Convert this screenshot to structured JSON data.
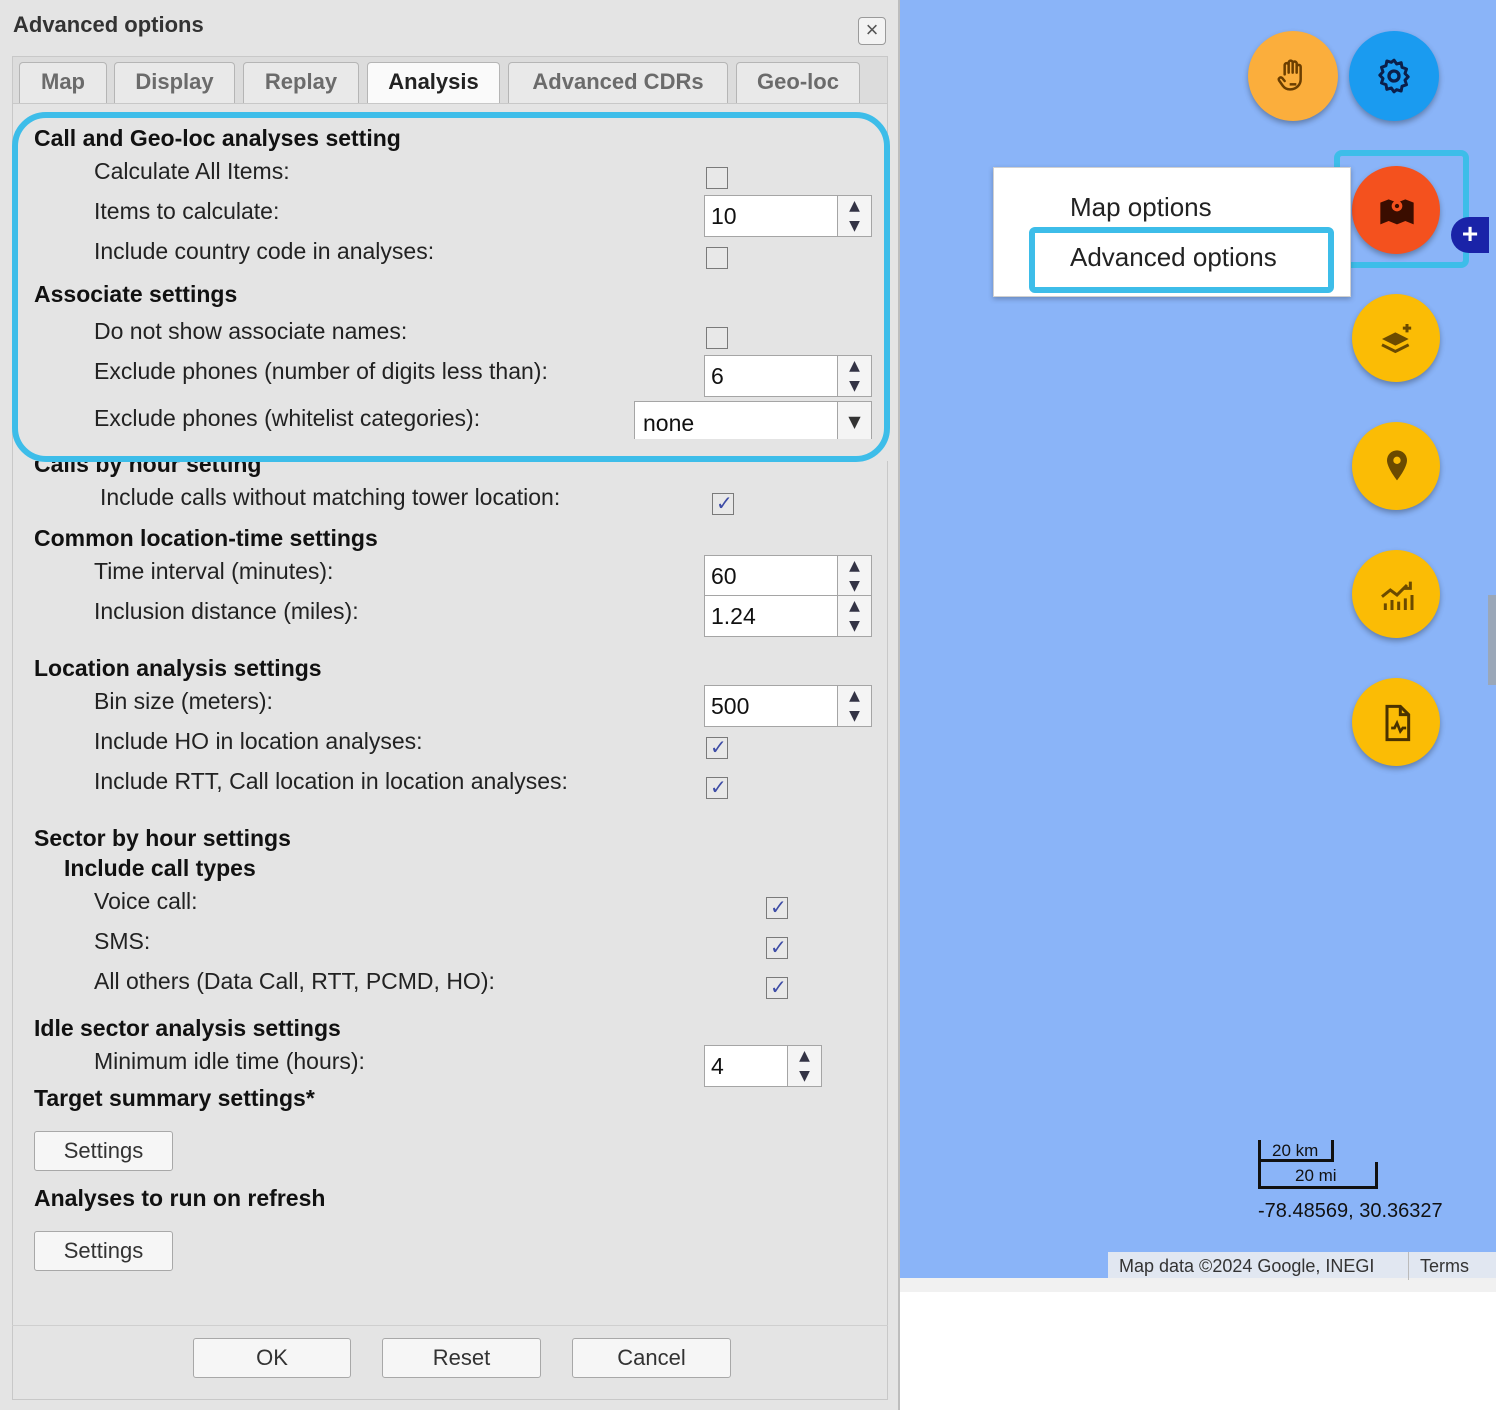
{
  "dialog": {
    "title": "Advanced options",
    "close_glyph": "×",
    "tabs": [
      "Map",
      "Display",
      "Replay",
      "Analysis",
      "Advanced CDRs",
      "Geo-loc"
    ],
    "active_tab": "Analysis",
    "sections": {
      "call_geo": {
        "heading": "Call and Geo-loc analyses setting",
        "calc_all_label": "Calculate All Items:",
        "calc_all_checked": false,
        "items_label": "Items to calculate:",
        "items_value": "10",
        "country_label": "Include country code in analyses:",
        "country_checked": false
      },
      "associate": {
        "heading": "Associate settings",
        "no_names_label": "Do not show associate names:",
        "no_names_checked": false,
        "exclude_digits_label": "Exclude phones (number of digits less than):",
        "exclude_digits_value": "6",
        "exclude_whitelist_label": "Exclude phones (whitelist categories):",
        "exclude_whitelist_value": "none"
      },
      "calls_by_hour": {
        "heading": "Calls by hour setting",
        "include_calls_label": "Include calls without matching tower location:",
        "include_calls_checked": true
      },
      "common": {
        "heading": "Common location-time settings",
        "interval_label": "Time interval (minutes):",
        "interval_value": "60",
        "distance_label": "Inclusion distance (miles):",
        "distance_value": "1.24"
      },
      "location": {
        "heading": "Location analysis settings",
        "bin_label": "Bin size (meters):",
        "bin_value": "500",
        "ho_label": "Include HO in location analyses:",
        "ho_checked": true,
        "rtt_label": "Include RTT, Call location in location analyses:",
        "rtt_checked": true
      },
      "sector": {
        "heading": "Sector by hour settings",
        "subheading": "Include call types",
        "voice_label": "Voice call:",
        "voice_checked": true,
        "sms_label": "SMS:",
        "sms_checked": true,
        "others_label": "All others (Data Call, RTT, PCMD, HO):",
        "others_checked": true
      },
      "idle": {
        "heading": "Idle sector analysis settings",
        "min_label": "Minimum idle time (hours):",
        "min_value": "4"
      },
      "target": {
        "heading": "Target summary settings*",
        "button": "Settings"
      },
      "refresh": {
        "heading": "Analyses to run on refresh",
        "button": "Settings"
      }
    },
    "footer": {
      "ok": "OK",
      "reset": "Reset",
      "cancel": "Cancel"
    }
  },
  "map": {
    "menu": {
      "map_options": "Map options",
      "advanced_options": "Advanced options"
    },
    "fab_icons": [
      "hand-icon",
      "gear-icon",
      "map-icon",
      "layers-add-icon",
      "location-pin-icon",
      "chart-icon",
      "document-chart-icon"
    ],
    "colors": {
      "map_bg": "#8ab4f8",
      "orange": "#fbae3c",
      "blue": "#1a9bf0",
      "red_orange": "#f4511e",
      "yellow": "#fbbc05",
      "highlight": "#3dbde9"
    },
    "plus_glyph": "+",
    "scale_km": "20 km",
    "scale_mi": "20 mi",
    "coordinates": "-78.48569, 30.36327",
    "attribution": "Map data ©2024 Google, INEGI",
    "terms": "Terms"
  }
}
